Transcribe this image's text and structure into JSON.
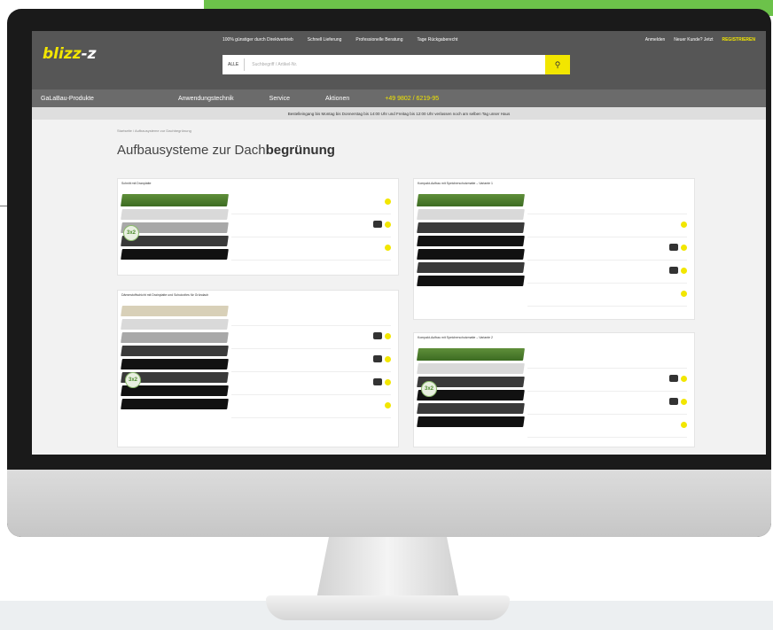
{
  "site": {
    "logo": "blizz",
    "logo_suffix": "-z",
    "top_links": [
      {
        "label": "100% günstiger durch Direktvertrieb"
      },
      {
        "label": "Schnell Lieferung"
      },
      {
        "label": "Professionelle Beratung"
      },
      {
        "label": "Tage Rückgaberecht"
      }
    ],
    "user_links": {
      "login": "Anmelden",
      "new_customer": "Neuer Kunde? Jetzt",
      "register": "REGISTRIEREN"
    },
    "search": {
      "category": "ALLE",
      "placeholder": "Suchbegriff / Artikel-Nr.",
      "button_icon": "search-icon"
    },
    "nav": {
      "products": "GaLaBau-Produkte",
      "items": [
        "Anwendungstechnik",
        "Service",
        "Aktionen"
      ],
      "phone": "+49 9802 / 6219-95"
    },
    "notice": "Bestelleingang bis Montag bis Donnerstag bis 14:00 Uhr und Freitag bis 12:00 Uhr verlassen noch am selben Tag unser Haus",
    "breadcrumb": "Startseite  /  Aufbausysteme zur Dachbegrünung",
    "page_title_prefix": "Aufbausysteme zur Dach",
    "page_title_bold": "begrünung"
  },
  "cards": [
    {
      "title": "Schnitt mit Dranplatte"
    },
    {
      "title": "Dämmstoffschicht mit Drainplatte und Schutzvlies für Gründach"
    },
    {
      "title": "Kompakt-Aufbau mit Speicherschutzmatte – Variante 1"
    },
    {
      "title": "Kompakt-Aufbau mit Speicherschutzmatte – Variante 2"
    }
  ],
  "badge": "3x2"
}
